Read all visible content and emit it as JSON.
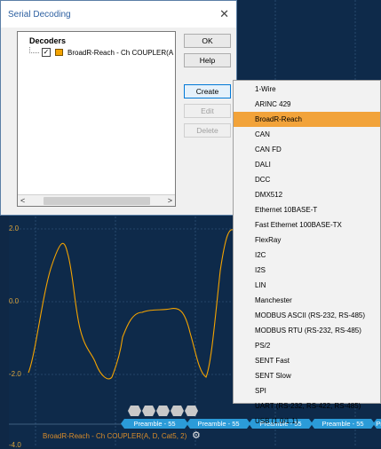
{
  "dialog": {
    "title": "Serial Decoding",
    "close_glyph": "✕",
    "tree_header": "Decoders",
    "decoder_label": "BroadR-Reach - Ch COUPLER(A",
    "checkbox_glyph": "✓",
    "scroll_left": "<",
    "scroll_right": ">"
  },
  "buttons": {
    "ok": "OK",
    "help": "Help",
    "create": "Create",
    "edit": "Edit",
    "delete": "Delete"
  },
  "menu": {
    "items": [
      "1-Wire",
      "ARINC 429",
      "BroadR-Reach",
      "CAN",
      "CAN FD",
      "DALI",
      "DCC",
      "DMX512",
      "Ethernet 10BASE-T",
      "Fast Ethernet 100BASE-TX",
      "FlexRay",
      "I2C",
      "I2S",
      "LIN",
      "Manchester",
      "MODBUS ASCII (RS-232, RS-485)",
      "MODBUS RTU (RS-232, RS-485)",
      "PS/2",
      "SENT Fast",
      "SENT Slow",
      "SPI",
      "UART (RS-232, RS-422, RS-485)",
      "USB (1.0/1.1)"
    ],
    "selected": "BroadR-Reach"
  },
  "scope": {
    "y_ticks": [
      "2.0",
      "0.0",
      "-2.0",
      "-4.0"
    ],
    "bus_label": "BroadR-Reach - Ch COUPLER(A, D, Cat5, 2)",
    "gear_glyph": "⚙",
    "packet_labels": [
      "Preamble - 55",
      "Preamble - 55",
      "Preamble - 55",
      "Preamble - 55",
      "Pr"
    ]
  },
  "colors": {
    "waveform": "#f4a300",
    "packet": "#2b9bd8",
    "background": "#0e2a4a",
    "menu_highlight": "#f2a33a"
  }
}
